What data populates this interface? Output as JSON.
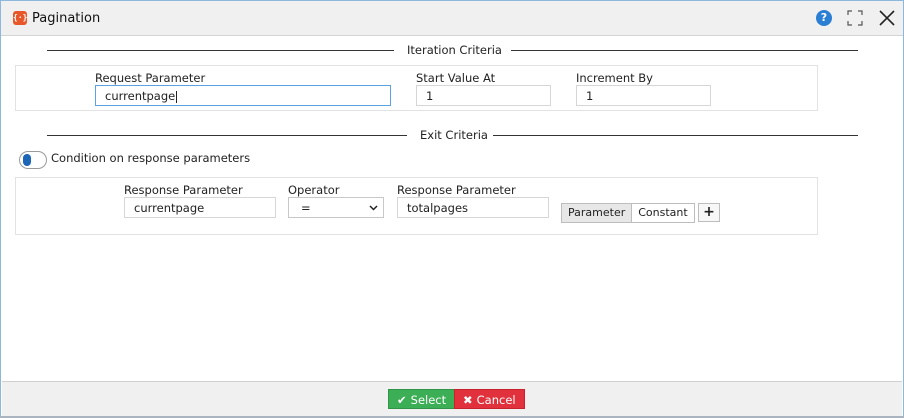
{
  "window": {
    "title": "Pagination",
    "app_icon_glyph": "{·}",
    "help_glyph": "?",
    "icons": [
      "app-icon",
      "help-icon",
      "maximize-icon",
      "close-icon"
    ],
    "border_color": "#8db7dc"
  },
  "iteration": {
    "heading": "Iteration Criteria",
    "request_parameter": {
      "label": "Request Parameter",
      "value": "currentpage"
    },
    "start_value": {
      "label": "Start Value At",
      "value": "1"
    },
    "increment_by": {
      "label": "Increment By",
      "value": "1"
    }
  },
  "exit": {
    "heading": "Exit Criteria",
    "toggle_label": "Condition on response parameters",
    "toggle_on": true,
    "response_parameter": {
      "label": "Response Parameter",
      "value": "currentpage"
    },
    "operator": {
      "label": "Operator",
      "value": "="
    },
    "response_parameter_2": {
      "label": "Response Parameter",
      "value": "totalpages"
    },
    "mode_options": [
      "Parameter",
      "Constant"
    ],
    "mode_selected": "Parameter",
    "add_glyph": "+"
  },
  "footer": {
    "select_label": "Select",
    "cancel_label": "Cancel",
    "select_color": "#3cae55",
    "cancel_color": "#e0313c"
  }
}
